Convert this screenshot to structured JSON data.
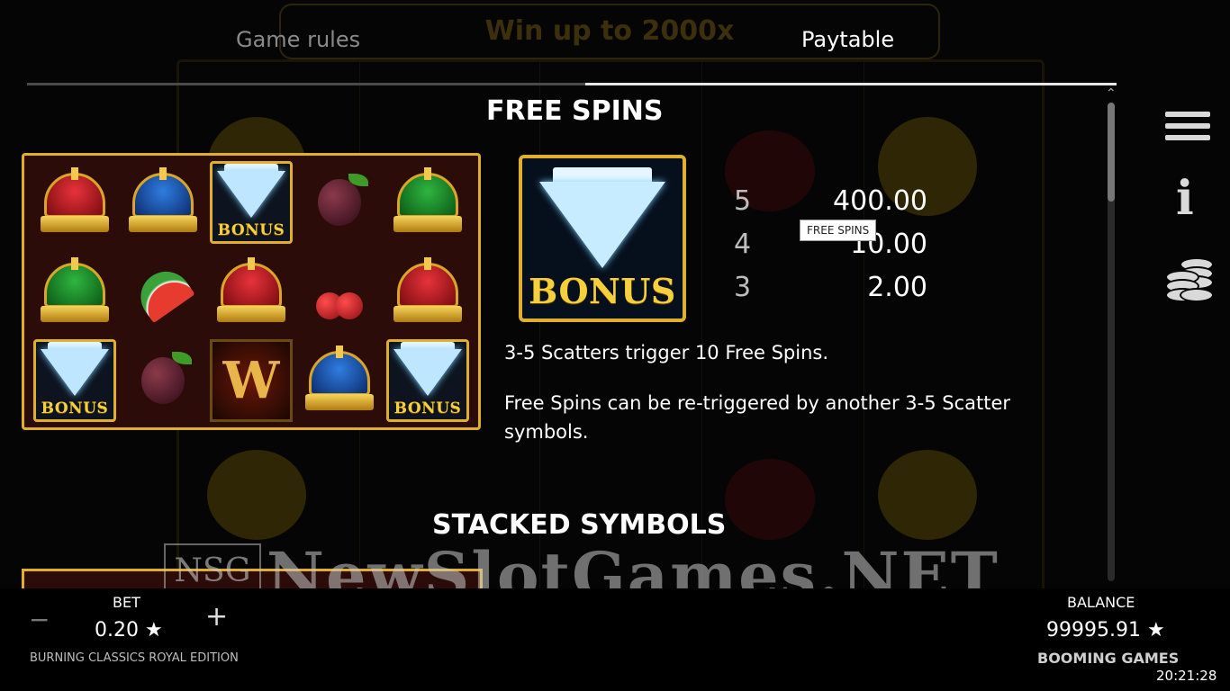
{
  "background": {
    "banner": "Win up to 2000x"
  },
  "tabs": [
    {
      "label": "Game rules",
      "active": false
    },
    {
      "label": "Paytable",
      "active": true
    }
  ],
  "free_spins": {
    "title": "FREE SPINS",
    "reel_grid": [
      [
        "crown-red",
        "crown-blue",
        "bonus-diamond",
        "plum",
        "crown-green"
      ],
      [
        "crown-green",
        "watermelon",
        "crown-red",
        "cherry",
        "crown-red"
      ],
      [
        "bonus-diamond",
        "plum",
        "wild",
        "crown-blue",
        "bonus-diamond"
      ]
    ],
    "bonus_label": "BONUS",
    "wild_label": "W",
    "payouts": [
      {
        "count": "5",
        "value": "400.00"
      },
      {
        "count": "4",
        "value": "10.00"
      },
      {
        "count": "3",
        "value": "2.00"
      }
    ],
    "tooltip": "FREE SPINS",
    "description_1": "3-5 Scatters trigger 10 Free Spins.",
    "description_2": "Free Spins can be re-triggered by another 3-5 Scatter symbols."
  },
  "stacked_symbols": {
    "title": "STACKED SYMBOLS"
  },
  "watermark": {
    "logo_text": "NSG",
    "text": "NewSlotGames.NET"
  },
  "bottom_bar": {
    "bet_label": "BET",
    "bet_value": "0.20 ★",
    "minus": "−",
    "plus": "+",
    "game_name": "BURNING CLASSICS ROYAL EDITION",
    "balance_label": "BALANCE",
    "balance_value": "99995.91 ★",
    "brand": "BOOMING GAMES",
    "clock": "20:21:28"
  },
  "icons": {
    "menu": "hamburger-icon",
    "info": "info-icon",
    "coins": "coins-icon"
  },
  "colors": {
    "gold_border": "#e0b02a",
    "background": "#050505",
    "inactive_tab": "#8a8a8a"
  }
}
